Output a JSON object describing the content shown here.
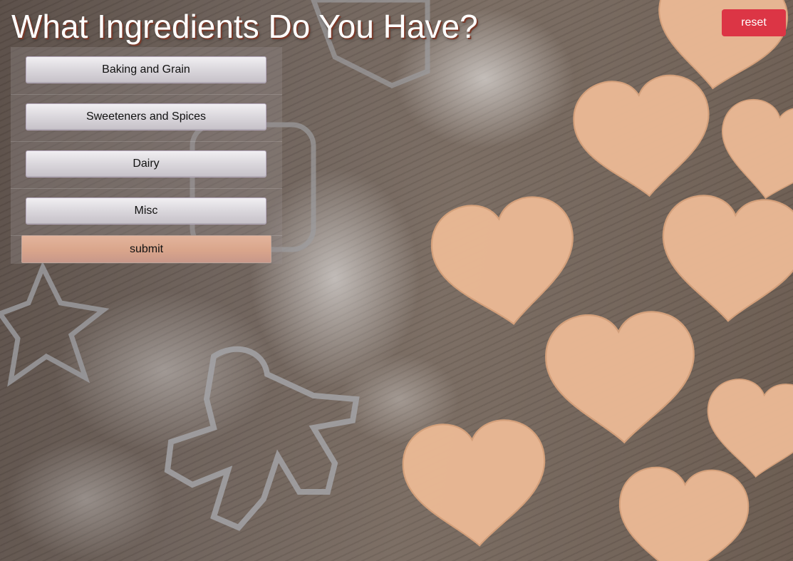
{
  "header": {
    "title": "What Ingredients Do You Have?",
    "reset_label": "reset"
  },
  "categories": [
    {
      "label": "Baking and Grain"
    },
    {
      "label": "Sweeteners and Spices"
    },
    {
      "label": "Dairy"
    },
    {
      "label": "Misc"
    }
  ],
  "submit_label": "submit",
  "colors": {
    "reset_button": "#dc3545",
    "submit_button": "#d9a58b",
    "category_button": "#dcd9de",
    "title_text": "#ffffff"
  }
}
